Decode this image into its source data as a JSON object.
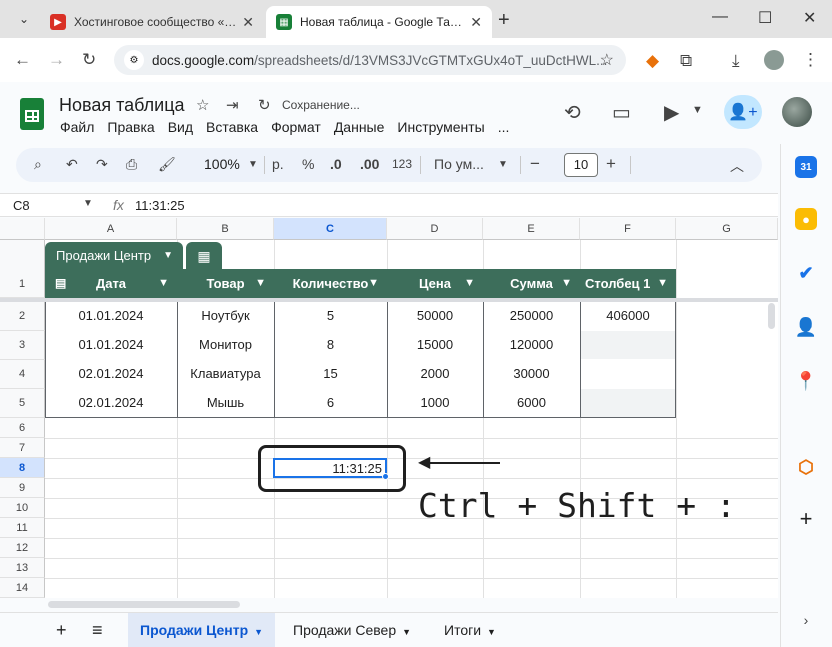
{
  "browser": {
    "tabs": [
      {
        "title": "Хостинговое сообщество «Timeweb",
        "active": false
      },
      {
        "title": "Новая таблица - Google Таблицы",
        "active": true
      }
    ],
    "url_host": "docs.google.com",
    "url_path": "/spreadsheets/d/13VMS3JVcGTMTxGUx4oT_uuDctHWL..."
  },
  "doc": {
    "title": "Новая таблица",
    "status": "Сохранение...",
    "menu": [
      "Файл",
      "Правка",
      "Вид",
      "Вставка",
      "Формат",
      "Данные",
      "Инструменты",
      "..."
    ]
  },
  "toolbar": {
    "zoom": "100%",
    "currency": "р.",
    "percent": "%",
    "dec_dec": ".0",
    "dec_inc": ".00",
    "more_formats": "123",
    "font": "По ум...",
    "font_size": "10",
    "minus": "−",
    "plus": "+"
  },
  "formula_bar": {
    "name_box": "C8",
    "fx": "fx",
    "value": "11:31:25"
  },
  "grid": {
    "columns": [
      "A",
      "B",
      "C",
      "D",
      "E",
      "F",
      "G"
    ],
    "rows": [
      "1",
      "2",
      "3",
      "4",
      "5",
      "6",
      "7",
      "8",
      "9",
      "10",
      "11",
      "12",
      "13",
      "14"
    ],
    "selected_column": "C",
    "selected_row": "8"
  },
  "table": {
    "name": "Продажи Центр",
    "headers": [
      "Дата",
      "Товар",
      "Количество",
      "Цена",
      "Сумма",
      "Столбец 1"
    ],
    "rows": [
      [
        "01.01.2024",
        "Ноутбук",
        "5",
        "50000",
        "250000",
        "406000"
      ],
      [
        "01.01.2024",
        "Монитор",
        "8",
        "15000",
        "120000",
        ""
      ],
      [
        "02.01.2024",
        "Клавиатура",
        "15",
        "2000",
        "30000",
        ""
      ],
      [
        "02.01.2024",
        "Мышь",
        "6",
        "1000",
        "6000",
        ""
      ]
    ]
  },
  "active_cell": {
    "ref": "C8",
    "value": "11:31:25"
  },
  "annotation": {
    "hotkey": "Ctrl + Shift + :"
  },
  "sheets": {
    "tabs": [
      "Продажи Центр",
      "Продажи Север",
      "Итоги"
    ],
    "active": "Продажи Центр"
  },
  "colors": {
    "table_header": "#3d6e5b",
    "selection": "#1a73e8",
    "accent": "#0b57d0"
  }
}
